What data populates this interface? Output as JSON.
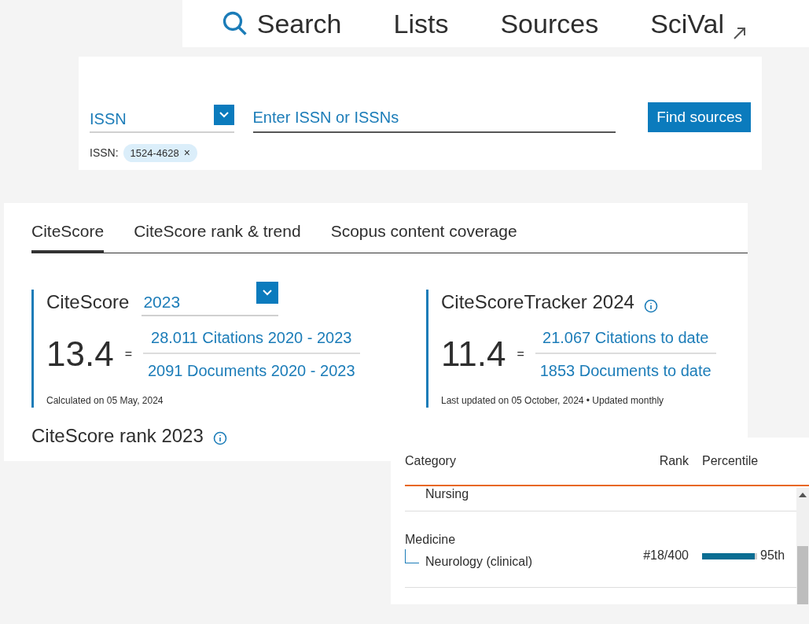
{
  "nav": [
    {
      "label": "Search",
      "kind": "search"
    },
    {
      "label": "Lists",
      "kind": "plain"
    },
    {
      "label": "Sources",
      "kind": "plain"
    },
    {
      "label": "SciVal",
      "kind": "external"
    }
  ],
  "search": {
    "field_type": "ISSN",
    "placeholder": "Enter ISSN or ISSNs",
    "button": "Find sources",
    "filter_label": "ISSN:",
    "chips": [
      {
        "label": "1524-4628",
        "remove": "×"
      }
    ]
  },
  "tabs": [
    {
      "label": "CiteScore",
      "selected": true
    },
    {
      "label": "CiteScore rank & trend",
      "selected": false
    },
    {
      "label": "Scopus content coverage",
      "selected": false
    }
  ],
  "citescore": {
    "title": "CiteScore",
    "year": "2023",
    "value": "13.4",
    "equals": "=",
    "numerator": "28.011 Citations 2020 - 2023",
    "denominator": "2091 Documents 2020 - 2023",
    "note": "Calculated on 05 May, 2024"
  },
  "tracker": {
    "title": "CiteScoreTracker 2024",
    "value": "11.4",
    "equals": "=",
    "numerator": "21.067 Citations to date",
    "denominator": "1853 Documents to date",
    "note": "Last updated on 05 October, 2024 • Updated monthly"
  },
  "rank": {
    "title": "CiteScore rank 2023"
  },
  "rank_table": {
    "columns": [
      "Category",
      "Rank",
      "Percentile"
    ],
    "rows": [
      {
        "kind": "subcategory_only",
        "subcategory": "Nursing"
      },
      {
        "kind": "full",
        "category": "Medicine",
        "subcategory": "Neurology (clinical)",
        "rank": "#18/400",
        "level": 0.95,
        "percentile": "95th"
      }
    ]
  }
}
